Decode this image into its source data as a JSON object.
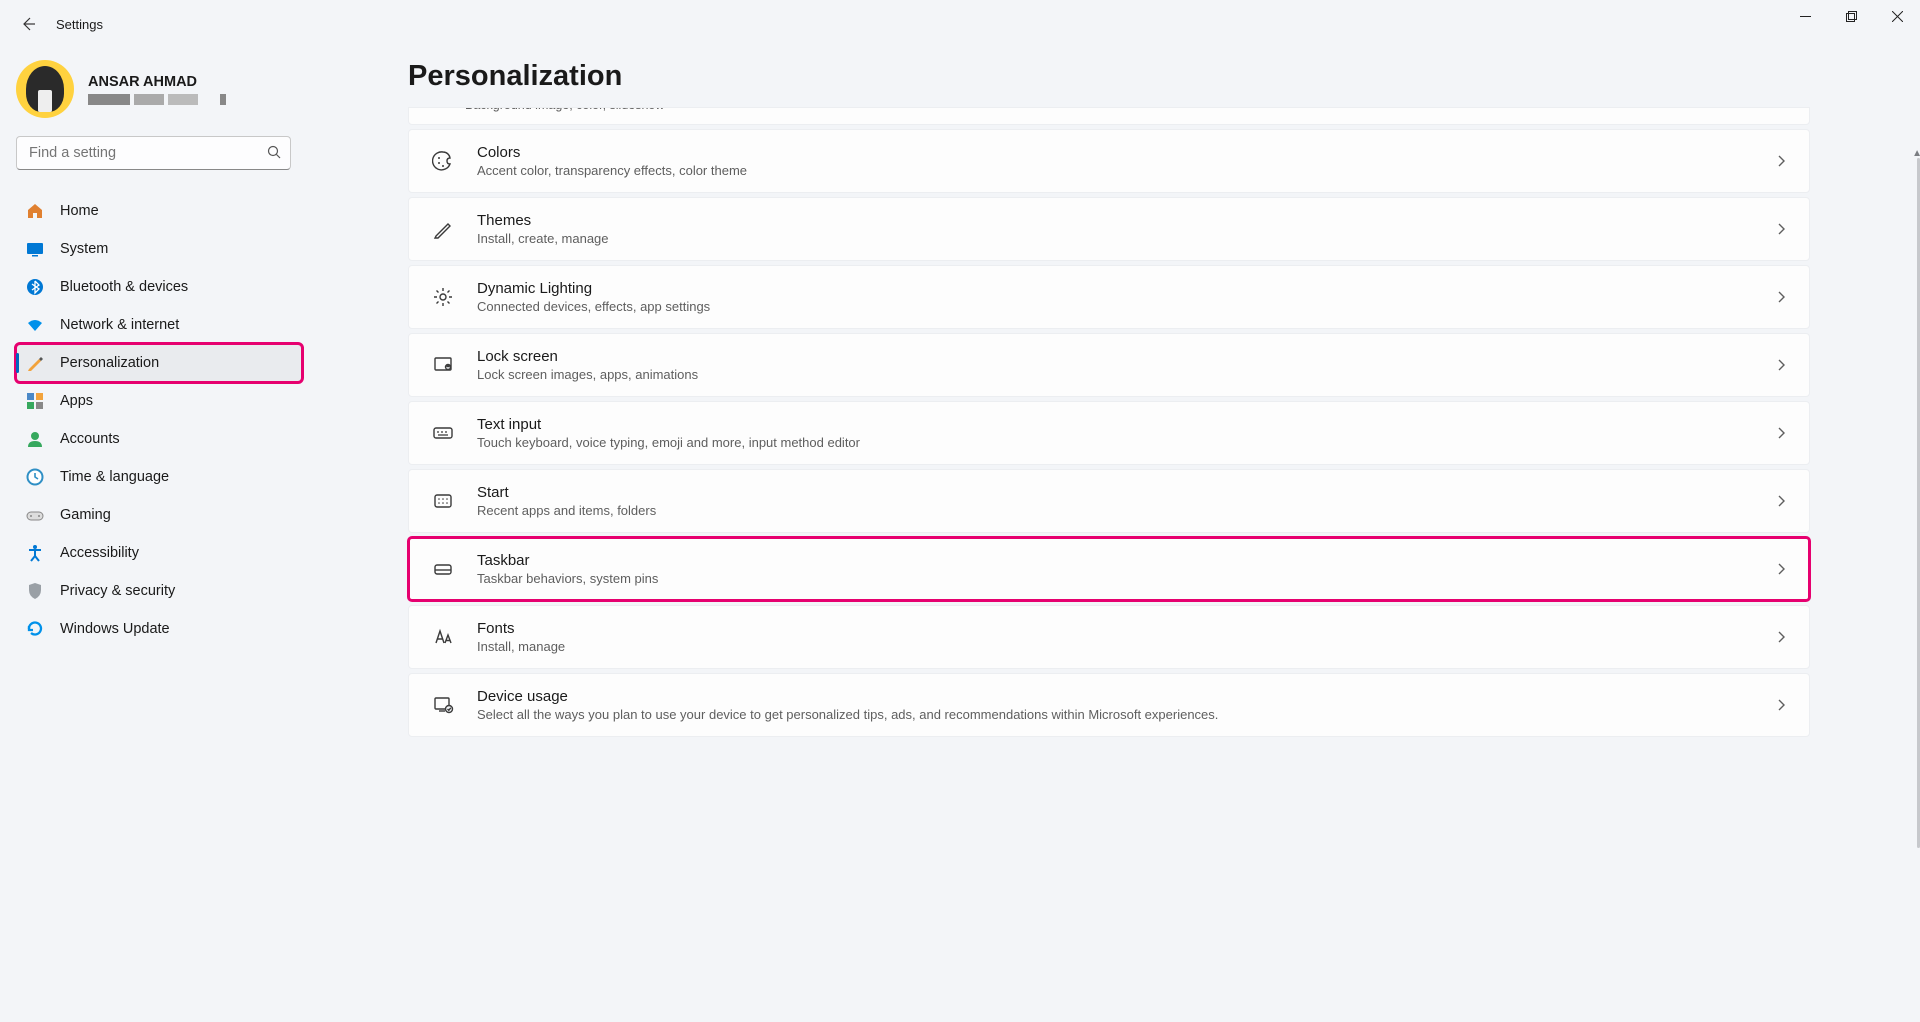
{
  "window": {
    "title": "Settings"
  },
  "profile": {
    "name": "ANSAR AHMAD"
  },
  "search": {
    "placeholder": "Find a setting"
  },
  "nav": [
    {
      "id": "home",
      "label": "Home",
      "active": false,
      "hl": false
    },
    {
      "id": "system",
      "label": "System",
      "active": false,
      "hl": false
    },
    {
      "id": "bluetooth",
      "label": "Bluetooth & devices",
      "active": false,
      "hl": false
    },
    {
      "id": "network",
      "label": "Network & internet",
      "active": false,
      "hl": false
    },
    {
      "id": "personalization",
      "label": "Personalization",
      "active": true,
      "hl": true
    },
    {
      "id": "apps",
      "label": "Apps",
      "active": false,
      "hl": false
    },
    {
      "id": "accounts",
      "label": "Accounts",
      "active": false,
      "hl": false
    },
    {
      "id": "time",
      "label": "Time & language",
      "active": false,
      "hl": false
    },
    {
      "id": "gaming",
      "label": "Gaming",
      "active": false,
      "hl": false
    },
    {
      "id": "accessibility",
      "label": "Accessibility",
      "active": false,
      "hl": false
    },
    {
      "id": "privacy",
      "label": "Privacy & security",
      "active": false,
      "hl": false
    },
    {
      "id": "update",
      "label": "Windows Update",
      "active": false,
      "hl": false
    }
  ],
  "page": {
    "title": "Personalization",
    "cropTop": "Background image, color, slideshow"
  },
  "cards": [
    {
      "id": "colors",
      "title": "Colors",
      "sub": "Accent color, transparency effects, color theme",
      "hl": false
    },
    {
      "id": "themes",
      "title": "Themes",
      "sub": "Install, create, manage",
      "hl": false
    },
    {
      "id": "dynamic",
      "title": "Dynamic Lighting",
      "sub": "Connected devices, effects, app settings",
      "hl": false
    },
    {
      "id": "lock",
      "title": "Lock screen",
      "sub": "Lock screen images, apps, animations",
      "hl": false
    },
    {
      "id": "textinput",
      "title": "Text input",
      "sub": "Touch keyboard, voice typing, emoji and more, input method editor",
      "hl": false
    },
    {
      "id": "start",
      "title": "Start",
      "sub": "Recent apps and items, folders",
      "hl": false
    },
    {
      "id": "taskbar",
      "title": "Taskbar",
      "sub": "Taskbar behaviors, system pins",
      "hl": true
    },
    {
      "id": "fonts",
      "title": "Fonts",
      "sub": "Install, manage",
      "hl": false
    },
    {
      "id": "device",
      "title": "Device usage",
      "sub": "Select all the ways you plan to use your device to get personalized tips, ads, and recommendations within Microsoft experiences.",
      "hl": false
    }
  ],
  "nav_icons": {
    "home": "#e08030",
    "system": "#0078d4",
    "bluetooth": "#0078d4",
    "network": "#0091ea",
    "personalization": "#f2a33c",
    "apps": "#4a88c7",
    "accounts": "#36a85e",
    "time": "#2f8fc5",
    "gaming": "#888",
    "accessibility": "#0078d4",
    "privacy": "#9aa0a6",
    "update": "#0091ea"
  }
}
